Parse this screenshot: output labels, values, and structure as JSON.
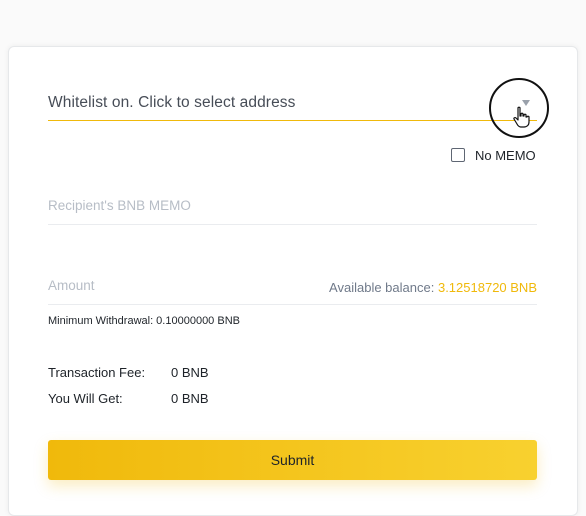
{
  "address": {
    "placeholder": "Whitelist on. Click to select address",
    "dropdown_icon": "caret-down-icon"
  },
  "no_memo": {
    "label": "No MEMO",
    "checked": false
  },
  "memo": {
    "placeholder": "Recipient's BNB MEMO"
  },
  "amount": {
    "placeholder": "Amount",
    "balance_label": "Available balance:",
    "balance_value": "3.12518720 BNB"
  },
  "min_withdrawal": "Minimum Withdrawal: 0.10000000 BNB",
  "fees": {
    "fee_label": "Transaction Fee:",
    "fee_value": "0 BNB",
    "get_label": "You Will Get:",
    "get_value": "0 BNB"
  },
  "submit_label": "Submit",
  "cursor_icon": "hand-pointer-icon",
  "colors": {
    "accent": "#f0b90b",
    "text": "#1e2329",
    "muted": "#707a8a"
  }
}
